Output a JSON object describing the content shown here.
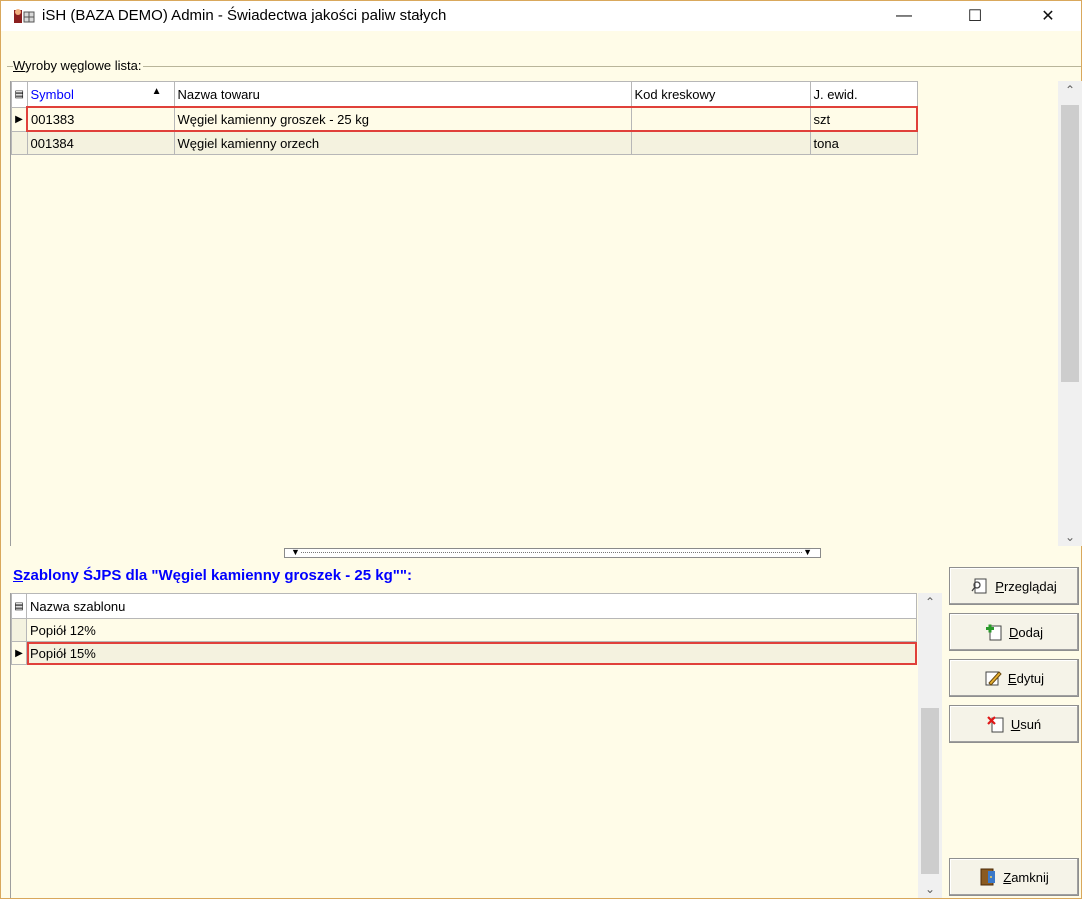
{
  "window": {
    "title": "iSH (BAZA DEMO) Admin - Świadectwa jakości paliw stałych",
    "min_label": "—",
    "max_label": "☐",
    "close_label": "✕"
  },
  "products": {
    "group_label_prefix": "W",
    "group_label_rest": "yroby węglowe lista:",
    "columns": [
      "Symbol",
      "Nazwa towaru",
      "Kod kreskowy",
      "J. ewid."
    ],
    "rows": [
      {
        "symbol": "001383",
        "name": "Węgiel kamienny groszek - 25 kg",
        "barcode": "",
        "unit": "szt"
      },
      {
        "symbol": "001384",
        "name": "Węgiel kamienny orzech",
        "barcode": "",
        "unit": "tona"
      }
    ]
  },
  "templates": {
    "title_prefix": "S",
    "title_rest": "zablony ŚJPS dla \"Węgiel kamienny groszek - 25 kg\"\":",
    "column": "Nazwa szablonu",
    "rows": [
      "Popiół 12%",
      "Popiół 15%"
    ],
    "selected_index": 1
  },
  "buttons": {
    "browse_u": "P",
    "browse_rest": "rzeglądaj",
    "add_u": "D",
    "add_rest": "odaj",
    "edit_u": "E",
    "edit_rest": "dytuj",
    "delete_u": "U",
    "delete_rest": "suń",
    "close_u": "Z",
    "close_rest": "amknij"
  },
  "icons": {
    "browse": "key-doc-icon",
    "add": "doc-add-icon",
    "edit": "pencil-icon",
    "delete": "doc-delete-icon",
    "close": "door-icon"
  }
}
